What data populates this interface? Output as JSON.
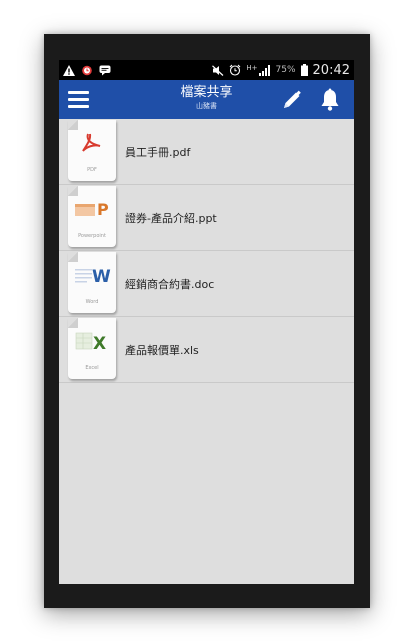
{
  "status_bar": {
    "time": "20:42",
    "battery_percent": "75%",
    "network": "H+",
    "left_icons": [
      "warning-icon",
      "alarm-clock-icon",
      "message-icon"
    ],
    "right_icons": [
      "mute-icon",
      "alarm-icon",
      "signal-icon",
      "battery-icon"
    ]
  },
  "app_bar": {
    "title": "檔案共享",
    "subtitle": "山豬書",
    "icons": [
      "menu-icon",
      "edit-pencil-icon",
      "bell-icon"
    ],
    "color": "#1f4fa8"
  },
  "files": [
    {
      "name": "員工手冊.pdf",
      "type_label": "PDF",
      "icon": "pdf-icon",
      "accent": "#d83b2f"
    },
    {
      "name": "證券-產品介紹.ppt",
      "type_label": "Powerpoint",
      "icon": "powerpoint-icon",
      "accent": "#d9782b"
    },
    {
      "name": "經銷商合約書.doc",
      "type_label": "Word",
      "icon": "word-icon",
      "accent": "#2b5fa8"
    },
    {
      "name": "產品報價單.xls",
      "type_label": "Excel",
      "icon": "excel-icon",
      "accent": "#3f7a2a"
    }
  ]
}
